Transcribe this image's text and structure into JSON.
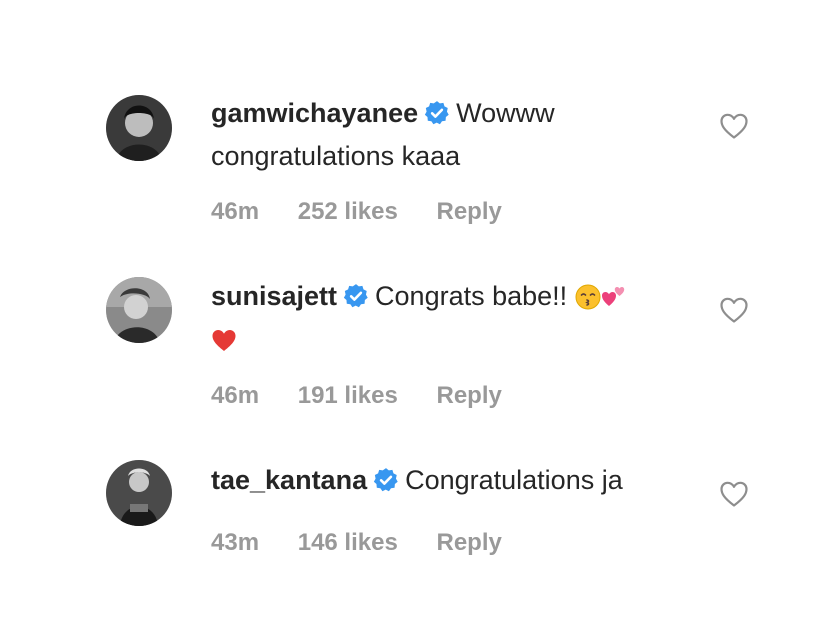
{
  "comments": [
    {
      "username": "gamwichayanee",
      "text_line1": "Wowww",
      "text_line2": "congratulations kaaa",
      "time": "46m",
      "likes": "252 likes",
      "reply": "Reply",
      "verified": true,
      "avatar_tone": "#2b2b2b"
    },
    {
      "username": "sunisajett",
      "text_line1": "Congrats babe!!",
      "emojis_line1": [
        "kissing-face-emoji",
        "two-hearts-emoji"
      ],
      "emojis_line2": [
        "red-heart-emoji"
      ],
      "time": "46m",
      "likes": "191 likes",
      "reply": "Reply",
      "verified": true,
      "avatar_tone": "#6e6e6e"
    },
    {
      "username": "tae_kantana",
      "text_line1": "Congratulations ja",
      "time": "43m",
      "likes": "146 likes",
      "reply": "Reply",
      "verified": true,
      "avatar_tone": "#3a3a3a"
    }
  ],
  "colors": {
    "text": "#262626",
    "meta": "#999999",
    "verified": "#3897f0",
    "heart_outline": "#8e8e8e"
  },
  "icons": {
    "verified": "verified-badge-icon",
    "like": "heart-outline-icon"
  }
}
